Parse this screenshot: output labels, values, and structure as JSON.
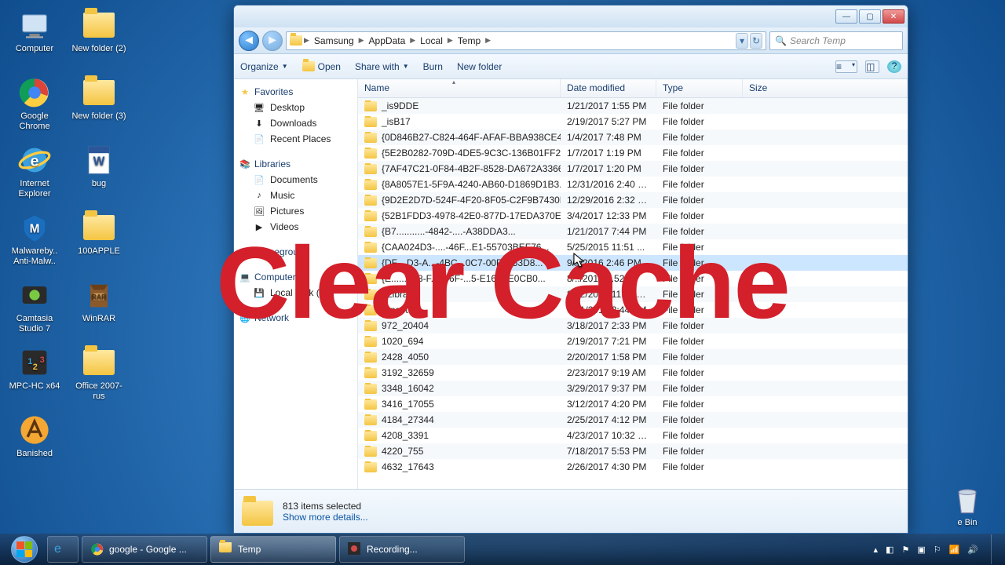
{
  "overlay_text": "Clear Cache",
  "desktop_icons": [
    {
      "label": "Computer",
      "icon": "computer"
    },
    {
      "label": "New folder (2)",
      "icon": "folder"
    },
    {
      "label": "Google Chrome",
      "icon": "chrome"
    },
    {
      "label": "New folder (3)",
      "icon": "folder"
    },
    {
      "label": "Internet Explorer",
      "icon": "ie"
    },
    {
      "label": "bug",
      "icon": "word"
    },
    {
      "label": "Malwareby.. Anti-Malw..",
      "icon": "mbam"
    },
    {
      "label": "100APPLE",
      "icon": "folder"
    },
    {
      "label": "Camtasia Studio 7",
      "icon": "camtasia"
    },
    {
      "label": "WinRAR",
      "icon": "winrar"
    },
    {
      "label": "MPC-HC x64",
      "icon": "mpc"
    },
    {
      "label": "Office 2007-rus",
      "icon": "folder"
    },
    {
      "label": "Banished",
      "icon": "banished"
    }
  ],
  "recycle_label": "e Bin",
  "window": {
    "title_btns": {
      "min": "—",
      "max": "▢",
      "close": "✕"
    },
    "breadcrumb": [
      "Samsung",
      "AppData",
      "Local",
      "Temp"
    ],
    "search_placeholder": "Search Temp",
    "toolbar": {
      "organize": "Organize",
      "open": "Open",
      "share": "Share with",
      "burn": "Burn",
      "newfolder": "New folder"
    },
    "columns": {
      "name": "Name",
      "date": "Date modified",
      "type": "Type",
      "size": "Size"
    },
    "nav": {
      "favorites": "Favorites",
      "desktop": "Desktop",
      "downloads": "Downloads",
      "recent": "Recent Places",
      "libraries": "Libraries",
      "documents": "Documents",
      "music": "Music",
      "pictures": "Pictures",
      "videos": "Videos",
      "homegroup": "Homegroup",
      "computer": "Computer",
      "localdisk": "Local Disk (C:)",
      "network": "Network"
    },
    "files": [
      {
        "name": "_is9DDE",
        "date": "1/21/2017 1:55 PM",
        "type": "File folder"
      },
      {
        "name": "_isB17",
        "date": "2/19/2017 5:27 PM",
        "type": "File folder"
      },
      {
        "name": "{0D846B27-C824-464F-AFAF-BBA938CE4...",
        "date": "1/4/2017 7:48 PM",
        "type": "File folder"
      },
      {
        "name": "{5E2B0282-709D-4DE5-9C3C-136B01FF2F...",
        "date": "1/7/2017 1:19 PM",
        "type": "File folder"
      },
      {
        "name": "{7AF47C21-0F84-4B2F-8528-DA672A3366...",
        "date": "1/7/2017 1:20 PM",
        "type": "File folder"
      },
      {
        "name": "{8A8057E1-5F9A-4240-AB60-D1869D1B3...",
        "date": "12/31/2016 2:40 PM",
        "type": "File folder"
      },
      {
        "name": "{9D2E2D7D-524F-4F20-8F05-C2F9B7430B...",
        "date": "12/29/2016 2:32 PM",
        "type": "File folder"
      },
      {
        "name": "{52B1FDD3-4978-42E0-877D-17EDA370EA...",
        "date": "3/4/2017 12:33 PM",
        "type": "File folder"
      },
      {
        "name": "{B7...........-4842-....-A38DDA3...",
        "date": "1/21/2017 7:44 PM",
        "type": "File folder"
      },
      {
        "name": "{CAA024D3-....-46F...E1-55703BEF76...",
        "date": "5/25/2015 11:51 ...",
        "type": "File folder"
      },
      {
        "name": "{DF....D3-A...-4BC...0C7-00F4553D8...",
        "date": "9/../2016 2:46 PM",
        "type": "File folder",
        "sel": true
      },
      {
        "name": "{E........F8-F...446F-...5-E160EE0CB0...",
        "date": "8/../2015 ...52",
        "type": "File folder"
      },
      {
        "name": "~Library",
        "date": "8/22/2019 11:39 AM",
        "type": "File folder"
      },
      {
        "name": "~rnsetup",
        "date": "6/21/2015 2:44 PM",
        "type": "File folder"
      },
      {
        "name": "972_20404",
        "date": "3/18/2017 2:33 PM",
        "type": "File folder"
      },
      {
        "name": "1020_694",
        "date": "2/19/2017 7:21 PM",
        "type": "File folder"
      },
      {
        "name": "2428_4050",
        "date": "2/20/2017 1:58 PM",
        "type": "File folder"
      },
      {
        "name": "3192_32659",
        "date": "2/23/2017 9:19 AM",
        "type": "File folder"
      },
      {
        "name": "3348_16042",
        "date": "3/29/2017 9:37 PM",
        "type": "File folder"
      },
      {
        "name": "3416_17055",
        "date": "3/12/2017 4:20 PM",
        "type": "File folder"
      },
      {
        "name": "4184_27344",
        "date": "2/25/2017 4:12 PM",
        "type": "File folder"
      },
      {
        "name": "4208_3391",
        "date": "4/23/2017 10:32 PM",
        "type": "File folder"
      },
      {
        "name": "4220_755",
        "date": "7/18/2017 5:53 PM",
        "type": "File folder"
      },
      {
        "name": "4632_17643",
        "date": "2/26/2017 4:30 PM",
        "type": "File folder"
      }
    ],
    "status": {
      "count": "813 items selected",
      "more": "Show more details..."
    }
  },
  "taskbar": {
    "items": [
      {
        "label": "google - Google ...",
        "icon": "chrome"
      },
      {
        "label": "Temp",
        "icon": "folder",
        "active": true
      },
      {
        "label": "Recording...",
        "icon": "rec"
      }
    ],
    "time": "",
    "date": ""
  }
}
